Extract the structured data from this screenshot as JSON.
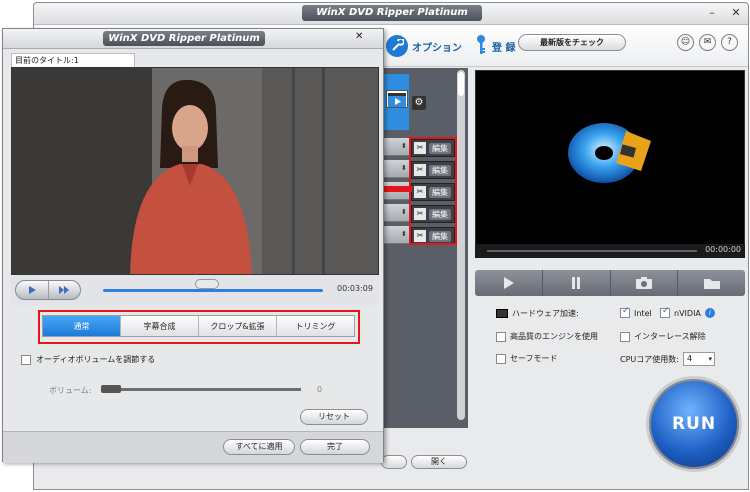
{
  "main": {
    "title": "WinX DVD Ripper Platinum",
    "toolbar": {
      "option_label": "オプション",
      "register_label": "登 録",
      "update_label": "最新版をチェック"
    },
    "edit_label": "編集",
    "preview_time": "00:00:00",
    "options": {
      "hw_accel": "ハードウェア加速:",
      "intel": "Intel",
      "nvidia": "nVIDIA",
      "hq_engine": "高品質のエンジンを使用",
      "deinterlace": "インターレース解除",
      "safe_mode": "セーフモード",
      "cpu_label": "CPUコア使用数:",
      "cpu_value": "4"
    },
    "run_label": "RUN",
    "open_label": "開く"
  },
  "dialog": {
    "title": "WinX DVD Ripper Platinum",
    "current_title": "目前のタイトル:1",
    "time": "00:03:09",
    "tabs": [
      "通常",
      "字幕合成",
      "クロップ&拡張",
      "トリミング"
    ],
    "adjust_volume": "オーディオボリュームを調節する",
    "volume_label": "ボリューム:",
    "volume_value": "0",
    "reset_label": "リセット",
    "apply_all_label": "すべてに適用",
    "done_label": "完了"
  }
}
